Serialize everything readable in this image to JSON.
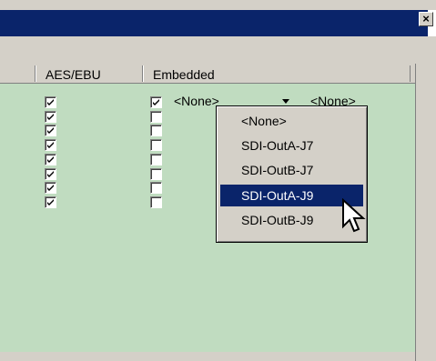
{
  "window": {
    "close_glyph": "×"
  },
  "columns": {
    "aes_ebu": "AES/EBU",
    "embedded": "Embedded"
  },
  "rows": [
    {
      "aes_ebu": true,
      "embedded": true,
      "embedded_value": "<None>",
      "next_value": "<None>"
    },
    {
      "aes_ebu": true,
      "embedded": false
    },
    {
      "aes_ebu": true,
      "embedded": false
    },
    {
      "aes_ebu": true,
      "embedded": false
    },
    {
      "aes_ebu": true,
      "embedded": false
    },
    {
      "aes_ebu": true,
      "embedded": false
    },
    {
      "aes_ebu": true,
      "embedded": false
    },
    {
      "aes_ebu": true,
      "embedded": false
    }
  ],
  "dropdown": {
    "options": [
      "<None>",
      "SDI-OutA-J7",
      "SDI-OutB-J7",
      "SDI-OutA-J9",
      "SDI-OutB-J9"
    ],
    "highlighted": "SDI-OutA-J9"
  },
  "colors": {
    "titlebar": "#0a246a",
    "list_background": "#c0dcc0",
    "highlight": "#0a246a",
    "chrome": "#d4d0c8"
  },
  "icons": {
    "cursor": "mouse-pointer-icon",
    "combo_arrow": "dropdown-arrow-icon",
    "close": "close-icon"
  }
}
